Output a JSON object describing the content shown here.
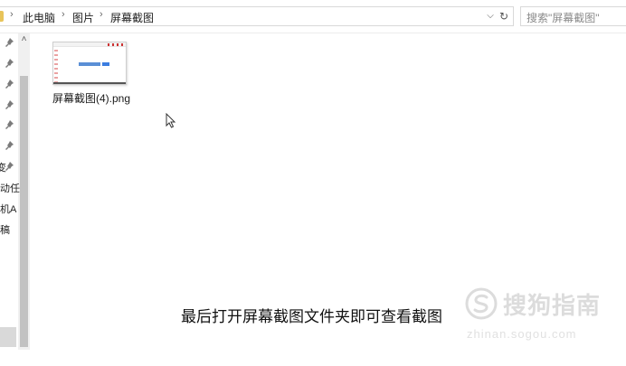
{
  "address_bar": {
    "breadcrumbs": [
      "此电脑",
      "图片",
      "屏幕截图"
    ],
    "separator": "›",
    "dropdown_glyph": "⌵",
    "refresh_glyph": "↻"
  },
  "search": {
    "placeholder": "搜索\"屏幕截图\""
  },
  "nav_pane": {
    "scroll_up_glyph": "˄",
    "items": [
      {
        "label": "",
        "pinned": true
      },
      {
        "label": "",
        "pinned": true
      },
      {
        "label": "",
        "pinned": true
      },
      {
        "label": "",
        "pinned": true
      },
      {
        "label": "",
        "pinned": true
      },
      {
        "label": "",
        "pinned": true
      },
      {
        "label": "变",
        "pinned": true
      },
      {
        "label": "动任",
        "pinned": false
      },
      {
        "label": "机A",
        "pinned": false
      },
      {
        "label": "稿",
        "pinned": false
      }
    ]
  },
  "files": [
    {
      "name": "屏幕截图(4).png",
      "icon": "png-thumbnail"
    }
  ],
  "caption": "最后打开屏幕截图文件夹即可查看截图",
  "watermark": {
    "brand": "搜狗指南",
    "url": "zhinan.sogou.com"
  },
  "colors": {
    "folder": "#e8c45a",
    "scrollbar_thumb": "#c2c2c2",
    "watermark": "#dcdcdc"
  }
}
